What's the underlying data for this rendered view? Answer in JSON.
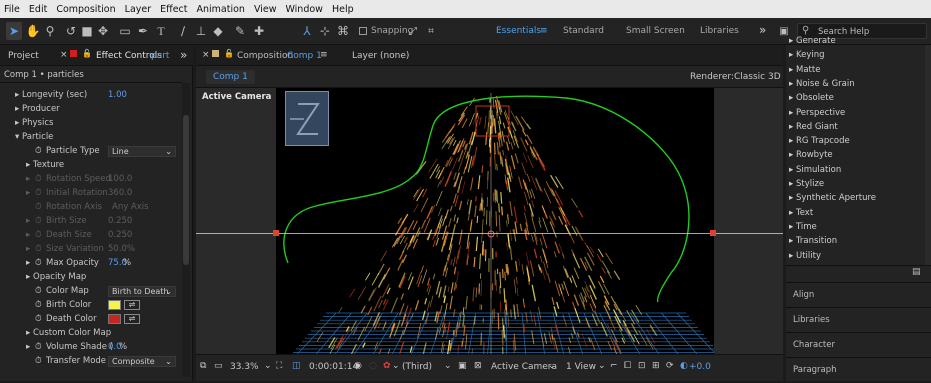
{
  "menu": [
    "File",
    "Edit",
    "Composition",
    "Layer",
    "Effect",
    "Animation",
    "View",
    "Window",
    "Help"
  ],
  "toolbar": {
    "snapping_label": "Snapping",
    "workspaces": [
      "Essentials",
      "Standard",
      "Small Screen",
      "Libraries"
    ],
    "more": "»",
    "search_placeholder": "Search Help"
  },
  "left_panel": {
    "tab_project": "Project",
    "tab_effect_controls": "Effect Controls",
    "tab_effect_target": "part",
    "more": "»",
    "breadcrumb": "Comp 1 • particles",
    "rows": {
      "longevity": {
        "label": "Longevity (sec)",
        "value": "1.00"
      },
      "producer": "Producer",
      "physics": "Physics",
      "particle": "Particle",
      "particle_type": {
        "label": "Particle Type",
        "value": "Line"
      },
      "texture": "Texture",
      "rotation_speed": {
        "label": "Rotation Speed",
        "value": "100.0"
      },
      "initial_rotation": {
        "label": "Initial Rotation",
        "value": "360.0"
      },
      "rotation_axis": {
        "label": "Rotation Axis",
        "value": "Any Axis"
      },
      "birth_size": {
        "label": "Birth Size",
        "value": "0.250"
      },
      "death_size": {
        "label": "Death Size",
        "value": "0.250"
      },
      "size_variation": {
        "label": "Size Variation",
        "value": "50.0%"
      },
      "max_opacity": {
        "label": "Max Opacity",
        "value": "75.0",
        "unit": "%"
      },
      "opacity_map": "Opacity Map",
      "color_map": {
        "label": "Color Map",
        "value": "Birth to Death"
      },
      "birth_color": {
        "label": "Birth Color",
        "color": "#f4f24e"
      },
      "death_color": {
        "label": "Death Color",
        "color": "#c8261e"
      },
      "custom_color_map": "Custom Color Map",
      "volume_shade": {
        "label": "Volume Shade (",
        "value": "0.0",
        "unit": "%"
      },
      "transfer_mode": {
        "label": "Transfer Mode",
        "value": "Composite"
      }
    }
  },
  "viewer": {
    "tab_prefix": "Composition",
    "tab_comp": "Comp 1",
    "tab_layer": "Layer (none)",
    "comp_chip": "Comp 1",
    "renderer_label": "Renderer:",
    "renderer_value": "Classic 3D",
    "active_camera": "Active Camera",
    "bottom": {
      "zoom": "33.3%",
      "timecode": "0:00:01:14",
      "resolution": "(Third)",
      "view": "Active Camera",
      "views": "1 View",
      "exposure": "+0.0"
    }
  },
  "effects": {
    "items": [
      "Generate",
      "Keying",
      "Matte",
      "Noise & Grain",
      "Obsolete",
      "Perspective",
      "Red Giant",
      "RG Trapcode",
      "Rowbyte",
      "Simulation",
      "Stylize",
      "Synthetic Aperture",
      "Text",
      "Time",
      "Transition",
      "Utility"
    ],
    "arrow": "▸"
  },
  "right_sections": [
    "Align",
    "Libraries",
    "Character",
    "Paragraph"
  ],
  "colors": {
    "accent": "#5b9ee8",
    "motion_path": "#22cc22",
    "grid": "#2a6ca8",
    "guides": "#cfcfcf"
  }
}
